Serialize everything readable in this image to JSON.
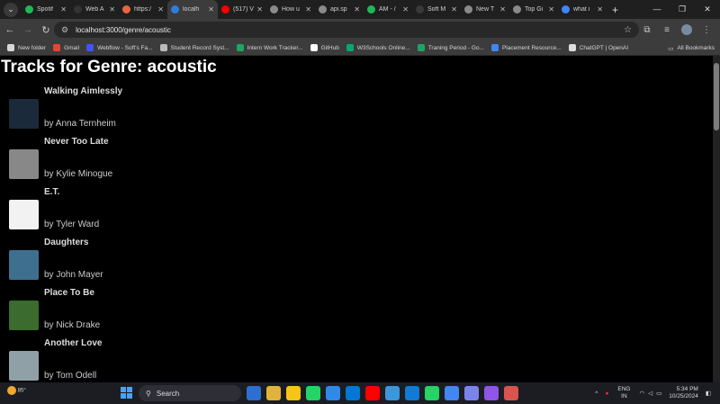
{
  "browser": {
    "tabs": [
      {
        "title": "Spotif",
        "color": "#1db954"
      },
      {
        "title": "Web A",
        "color": "#333333"
      },
      {
        "title": "https:/",
        "color": "#e8663d"
      },
      {
        "title": "localh",
        "color": "#2f7ce0",
        "active": true
      },
      {
        "title": "(517) V",
        "color": "#ff0000"
      },
      {
        "title": "How u",
        "color": "#8a8a8a"
      },
      {
        "title": "api.sp",
        "color": "#8a8a8a"
      },
      {
        "title": "AM - /",
        "color": "#1db954"
      },
      {
        "title": "Soft M",
        "color": "#3a3a3a"
      },
      {
        "title": "New T",
        "color": "#8a8a8a"
      },
      {
        "title": "Top Gi",
        "color": "#8a8a8a"
      },
      {
        "title": "what i",
        "color": "#4285f4"
      }
    ],
    "new_tab": "+",
    "window_controls": {
      "minimize": "—",
      "maximize": "❐",
      "close": "✕"
    },
    "url": "localhost:3000/genre/acoustic",
    "bookmarks": [
      {
        "label": "New folder",
        "color": "#d8d8d8"
      },
      {
        "label": "Gmail",
        "color": "#ea4335"
      },
      {
        "label": "Webflow - Soft's Fa...",
        "color": "#4353ff"
      },
      {
        "label": "Student Record Syst...",
        "color": "#bbbbbb"
      },
      {
        "label": "Intern Work Tracker...",
        "color": "#1fa463"
      },
      {
        "label": "GitHub",
        "color": "#ffffff"
      },
      {
        "label": "W3Schools Online...",
        "color": "#04aa6d"
      },
      {
        "label": "Traning Period - Go...",
        "color": "#1fa463"
      },
      {
        "label": "Placement Resource...",
        "color": "#4285f4"
      },
      {
        "label": "ChatGPT | OpenAI",
        "color": "#dddddd"
      }
    ],
    "all_bookmarks": "All Bookmarks"
  },
  "page": {
    "heading": "Tracks for Genre: acoustic",
    "tracks": [
      {
        "name": "Walking Aimlessly",
        "artist": "by Anna Ternheim",
        "thumb": "#1b2a3a"
      },
      {
        "name": "Never Too Late",
        "artist": "by Kylie Minogue",
        "thumb": "#888888"
      },
      {
        "name": "E.T.",
        "artist": "by Tyler Ward",
        "thumb": "#f2f2f2"
      },
      {
        "name": "Daughters",
        "artist": "by John Mayer",
        "thumb": "#3f6f8f"
      },
      {
        "name": "Place To Be",
        "artist": "by Nick Drake",
        "thumb": "#3b6b2e"
      },
      {
        "name": "Another Love",
        "artist": "by Tom Odell",
        "thumb": "#8fa0a6"
      }
    ]
  },
  "taskbar": {
    "weather_temp": "85°",
    "search_label": "Search",
    "apps": [
      "#2c6fd1",
      "#e2b33b",
      "#f5c518",
      "#25d366",
      "#2f89ea",
      "#0078d4",
      "#ff0000",
      "#3a96dd",
      "#0f7bd6",
      "#25d366",
      "#4285f4",
      "#7b83eb",
      "#8f54e8",
      "#d9534f"
    ],
    "lang": "ENG",
    "region": "IN",
    "time": "5:34 PM",
    "date": "10/25/2024"
  }
}
